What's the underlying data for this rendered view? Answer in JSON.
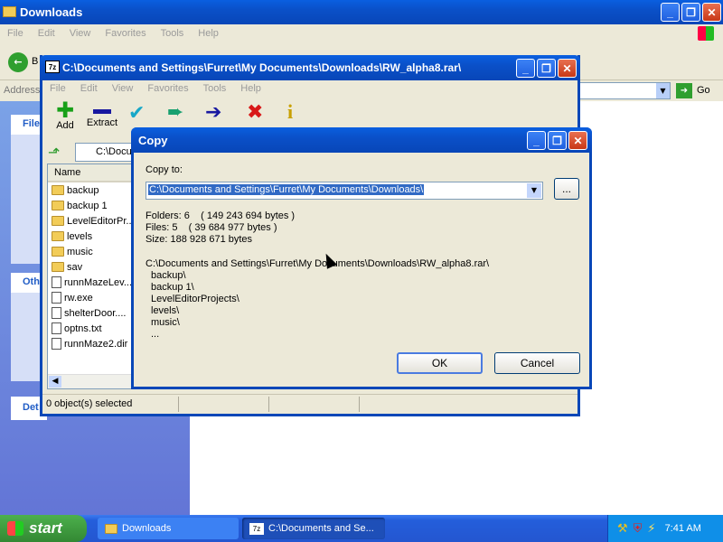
{
  "explorer": {
    "title": "Downloads",
    "menu": [
      "File",
      "Edit",
      "View",
      "Favorites",
      "Tools",
      "Help"
    ],
    "back_label": "B",
    "address_label": "Address",
    "go_label": "Go",
    "panel_labels": [
      "File",
      "Oth",
      "Det"
    ]
  },
  "sevenzip": {
    "title": "C:\\Documents and Settings\\Furret\\My Documents\\Downloads\\RW_alpha8.rar\\",
    "menu": [
      "File",
      "Edit",
      "View",
      "Favorites",
      "Tools",
      "Help"
    ],
    "toolbar": [
      {
        "label": "Add",
        "icon": "add-icon"
      },
      {
        "label": "Extract",
        "icon": "extract-icon"
      },
      {
        "label": "",
        "icon": "test-icon"
      },
      {
        "label": "",
        "icon": "copy-icon"
      },
      {
        "label": "",
        "icon": "move-icon"
      },
      {
        "label": "",
        "icon": "delete-icon"
      },
      {
        "label": "",
        "icon": "info-icon"
      }
    ],
    "path_text": "C:\\Docu",
    "column_name": "Name",
    "files": [
      {
        "name": "backup",
        "type": "folder"
      },
      {
        "name": "backup 1",
        "type": "folder"
      },
      {
        "name": "LevelEditorPr...",
        "type": "folder"
      },
      {
        "name": "levels",
        "type": "folder"
      },
      {
        "name": "music",
        "type": "folder"
      },
      {
        "name": "sav",
        "type": "folder"
      },
      {
        "name": "runnMazeLev...",
        "type": "file"
      },
      {
        "name": "rw.exe",
        "type": "file"
      },
      {
        "name": "shelterDoor....",
        "type": "file"
      },
      {
        "name": "optns.txt",
        "type": "file"
      },
      {
        "name": "runnMaze2.dir",
        "type": "file"
      }
    ],
    "status": "0 object(s) selected"
  },
  "dialog": {
    "title": "Copy",
    "copy_to_label": "Copy to:",
    "copy_to_value": "C:\\Documents and Settings\\Furret\\My Documents\\Downloads\\",
    "browse_label": "...",
    "folders": "Folders: 6    ( 149 243 694 bytes )",
    "files": "Files: 5    ( 39 684 977 bytes )",
    "size": "Size: 188 928 671 bytes",
    "source_path": "C:\\Documents and Settings\\Furret\\My Documents\\Downloads\\RW_alpha8.rar\\",
    "items": [
      "backup\\",
      "backup 1\\",
      "LevelEditorProjects\\",
      "levels\\",
      "music\\",
      "..."
    ],
    "ok_label": "OK",
    "cancel_label": "Cancel"
  },
  "taskbar": {
    "start_label": "start",
    "tasks": [
      "Downloads",
      "C:\\Documents and Se..."
    ],
    "clock": "7:41 AM"
  },
  "colors": {
    "xp_blue": "#0a50c8",
    "taskbar": "#245edb",
    "start": "#3a9a3a",
    "tray": "#0f8fe8",
    "face": "#ece9d8"
  }
}
